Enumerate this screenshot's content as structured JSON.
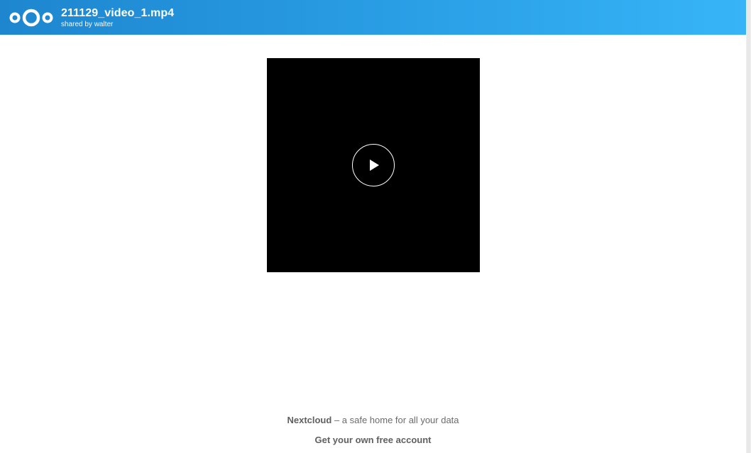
{
  "header": {
    "logo_icon": "nextcloud-logo-icon",
    "title": "211129_video_1.mp4",
    "subtitle": "shared by walter",
    "gradient_colors": [
      "#1d86cf",
      "#37b4f8"
    ]
  },
  "player": {
    "play_icon": "play-icon"
  },
  "footer": {
    "brand": "Nextcloud",
    "tagline_rest": " – a safe home for all your data",
    "cta_label": "Get your own free account"
  }
}
